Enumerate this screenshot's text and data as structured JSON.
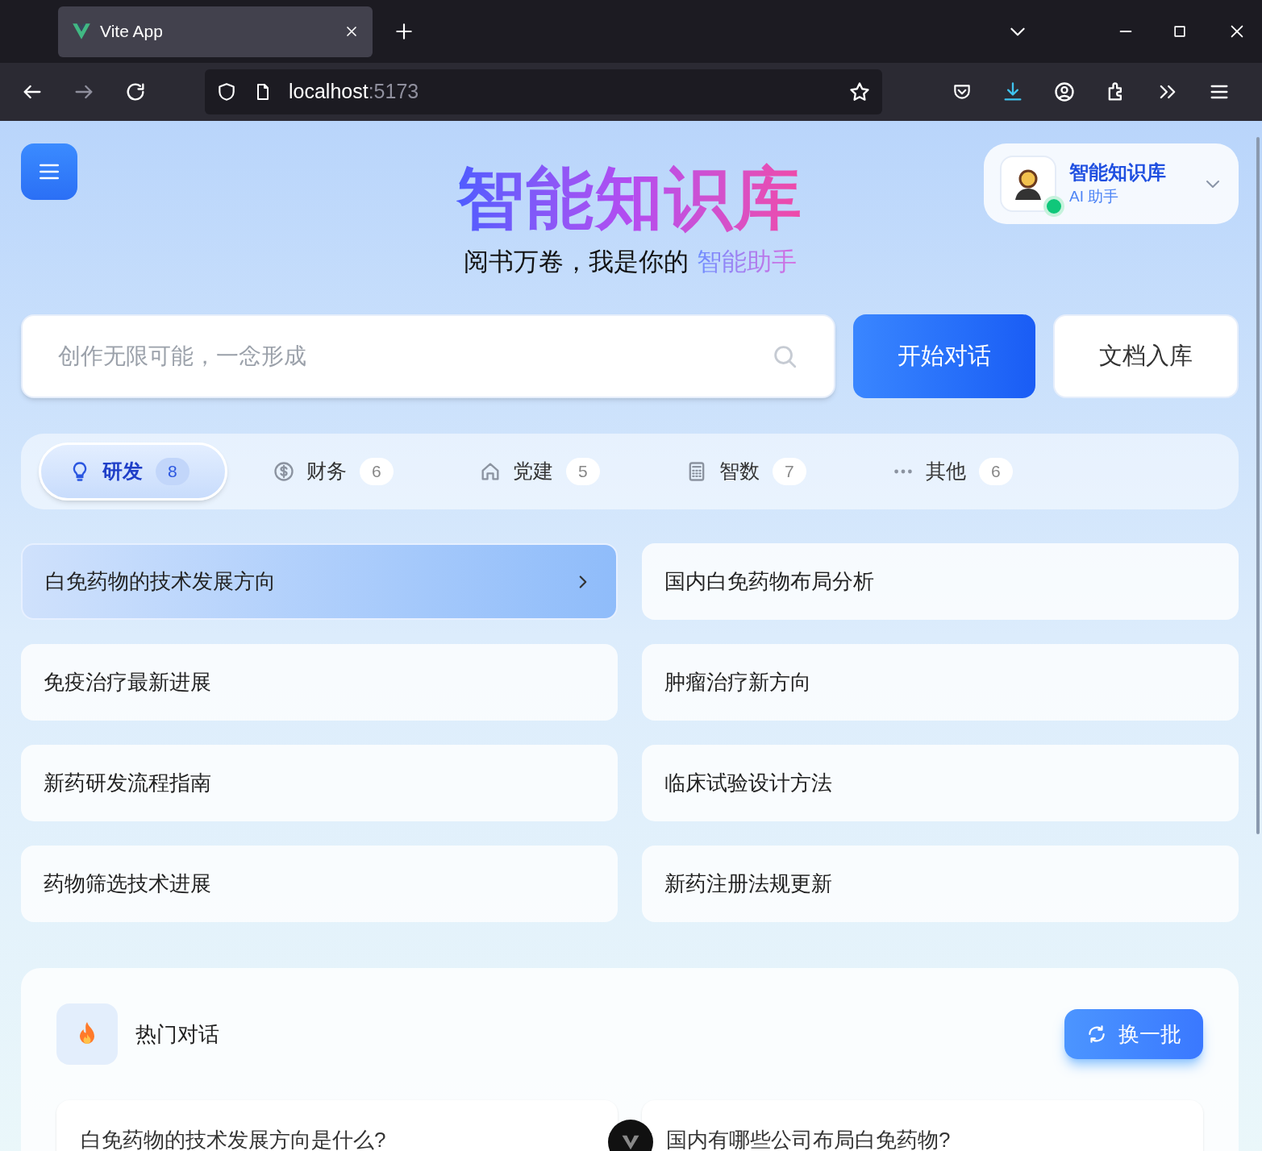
{
  "browser": {
    "tab_title": "Vite App",
    "url_host": "localhost",
    "url_port": ":5173"
  },
  "header": {
    "title": "智能知识库",
    "subtitle": "阅书万卷，我是你的",
    "subtitle_highlight": "智能助手",
    "assistant": {
      "name": "智能知识库",
      "role": "AI 助手",
      "online": true
    }
  },
  "search": {
    "placeholder": "创作无限可能，一念形成"
  },
  "actions": [
    {
      "label": "开始对话",
      "kind": "primary"
    },
    {
      "label": "文档入库",
      "kind": "secondary"
    }
  ],
  "categories": [
    {
      "label": "研发",
      "count": "8",
      "kind": "bulb",
      "selected": true
    },
    {
      "label": "财务",
      "count": "6",
      "kind": "dollar",
      "selected": false
    },
    {
      "label": "党建",
      "count": "5",
      "kind": "house",
      "selected": false
    },
    {
      "label": "智数",
      "count": "7",
      "kind": "calculator",
      "selected": false
    },
    {
      "label": "其他",
      "count": "6",
      "kind": "dots",
      "selected": false
    }
  ],
  "questions": [
    {
      "text": "白免药物的技术发展方向",
      "selected": true
    },
    {
      "text": "国内白免药物布局分析",
      "selected": false
    },
    {
      "text": "免疫治疗最新进展",
      "selected": false
    },
    {
      "text": "肿瘤治疗新方向",
      "selected": false
    },
    {
      "text": "新药研发流程指南",
      "selected": false
    },
    {
      "text": "临床试验设计方法",
      "selected": false
    },
    {
      "text": "药物筛选技术进展",
      "selected": false
    },
    {
      "text": "新药注册法规更新",
      "selected": false
    }
  ],
  "hot": {
    "title": "热门对话",
    "refresh_button": "换一批",
    "questions": [
      "白免药物的技术发展方向是什么?",
      "国内有哪些公司布局白免药物?"
    ]
  }
}
